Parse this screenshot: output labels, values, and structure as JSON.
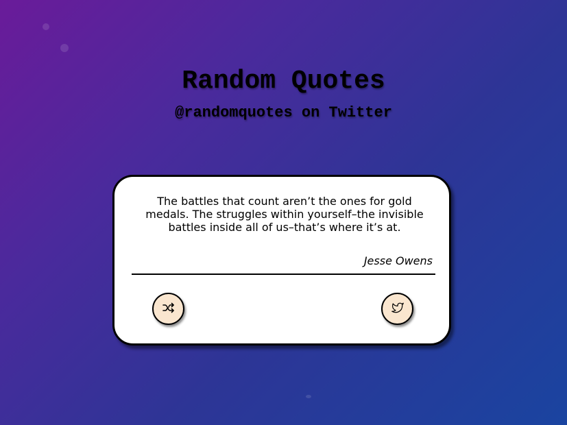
{
  "header": {
    "title": "Random Quotes",
    "subtitle": "@randomquotes on Twitter"
  },
  "quote": {
    "text": "The battles that count aren’t the ones for gold medals. The struggles within yourself–the invisible battles inside all of us–that’s where it’s at.",
    "author": "Jesse Owens"
  },
  "buttons": {
    "new_quote_icon": "shuffle-icon",
    "tweet_icon": "twitter-icon"
  },
  "colors": {
    "gradient_start": "#6a1b9a",
    "gradient_end": "#1a44a0",
    "button_fill": "#fae6cf",
    "card": "#ffffff"
  }
}
